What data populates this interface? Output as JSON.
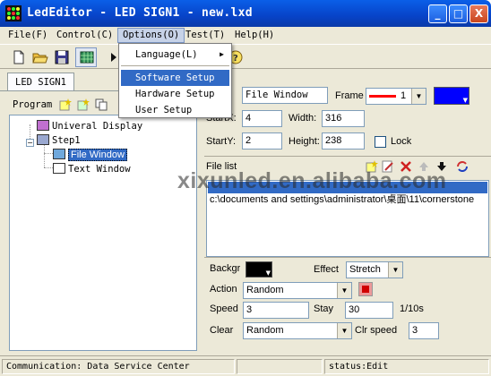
{
  "window": {
    "title": "LedEditor - LED SIGN1 - new.lxd",
    "controls": {
      "minimize": "_",
      "maximize": "□",
      "close": "X"
    }
  },
  "menubar": {
    "items": [
      {
        "label": "File(F)"
      },
      {
        "label": "Control(C)"
      },
      {
        "label": "Options(O)"
      },
      {
        "label": "Test(T)"
      },
      {
        "label": "Help(H)"
      }
    ],
    "open_menu": "Options(O)"
  },
  "options_menu": {
    "items": [
      {
        "label": "Language(L)",
        "has_submenu": true
      },
      {
        "label": "Software Setup",
        "highlighted": true
      },
      {
        "label": "Hardware Setup"
      },
      {
        "label": "User Setup"
      }
    ]
  },
  "toolbar": {
    "icons": [
      "new-file-icon",
      "open-folder-icon",
      "save-icon",
      "grid-icon",
      "play-icon",
      "help-icon"
    ]
  },
  "tab": {
    "label": "LED SIGN1"
  },
  "program_panel": {
    "label": "Program",
    "tree": [
      {
        "label": "Univeral Display",
        "icon": "display-icon"
      },
      {
        "label": "Step1",
        "icon": "step-icon"
      },
      {
        "label": "File Window",
        "icon": "file-window-icon",
        "selected": true
      },
      {
        "label": "Text Window",
        "icon": "text-window-icon"
      }
    ]
  },
  "properties": {
    "window_name": "File Window",
    "frame_label": "Frame",
    "frame_value": "1",
    "startx_label": "StartX:",
    "startx": "4",
    "width_label": "Width:",
    "width": "316",
    "starty_label": "StartY:",
    "starty": "2",
    "height_label": "Height:",
    "height": "238",
    "lock_label": "Lock",
    "frame_color": "#ff0000",
    "color_swatch": "#0000ff"
  },
  "file_list": {
    "label": "File list",
    "rows": [
      {
        "text": "",
        "selected": true
      },
      {
        "text": "c:\\documents and settings\\administrator\\桌面\\11\\cornerstone"
      }
    ]
  },
  "effects": {
    "background_label": "Backgr",
    "background_color": "#000000",
    "effect_label": "Effect",
    "effect_value": "Stretch",
    "action_label": "Action",
    "action_value": "Random",
    "speed_label": "Speed",
    "speed_value": "3",
    "stay_label": "Stay",
    "stay_value": "30",
    "stay_unit": "1/10s",
    "clear_label": "Clear",
    "clear_value": "Random",
    "clr_speed_label": "Clr speed",
    "clr_speed_value": "3"
  },
  "watermark": {
    "text": "xixunled.en.alibaba.com"
  },
  "statusbar": {
    "communication": "Communication: Data Service Center",
    "middle": "",
    "status": "status:Edit"
  }
}
